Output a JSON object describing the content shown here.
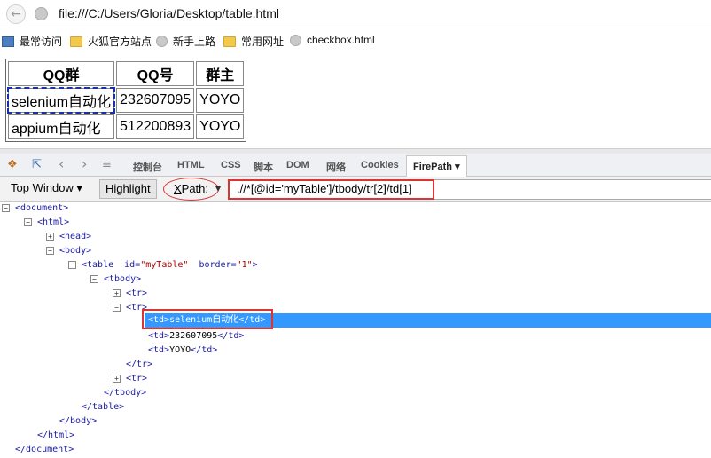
{
  "browser": {
    "url": "file:///C:/Users/Gloria/Desktop/table.html",
    "bookmarks": [
      {
        "label": "最常访问",
        "icon": "bookmarks-star-icon"
      },
      {
        "label": "火狐官方站点",
        "icon": "folder-icon"
      },
      {
        "label": "新手上路",
        "icon": "globe-icon"
      },
      {
        "label": "常用网址",
        "icon": "folder-icon"
      },
      {
        "label": "checkbox.html",
        "icon": "globe-icon"
      }
    ]
  },
  "page_table": {
    "headers": [
      "QQ群",
      "QQ号",
      "群主"
    ],
    "rows": [
      [
        "selenium自动化",
        "232607095",
        "YOYO"
      ],
      [
        "appium自动化",
        "512200893",
        "YOYO"
      ]
    ]
  },
  "devtools": {
    "tabs": [
      "控制台",
      "HTML",
      "CSS",
      "脚本",
      "DOM",
      "网络",
      "Cookies",
      "FirePath ▾"
    ],
    "window_select": "Top Window ▾",
    "highlight": "Highlight",
    "xpath_label_x": "X",
    "xpath_label_rest": "Path:",
    "xpath_value": ".//*[@id='myTable']/tbody/tr[2]/td[1]"
  },
  "tree": {
    "document_open": "<document>",
    "html_open": "<html>",
    "head": "<head>",
    "body_open": "<body>",
    "table_tag_start": "<table  id=",
    "table_id": "\"myTable\"",
    "table_border_attr": "  border=",
    "table_border_val": "\"1\"",
    "table_tag_end": ">",
    "tbody_open": "<tbody>",
    "tr_collapsed_1": "<tr>",
    "tr_open": "<tr>",
    "td1": "<td>selenium自动化</td>",
    "td2_open": "<td>",
    "td2_text": "232607095",
    "td2_close": "</td>",
    "td3_open": "<td>",
    "td3_text": "YOYO",
    "td3_close": "</td>",
    "tr_close": "</tr>",
    "tr_collapsed_2": "<tr>",
    "tbody_close": "</tbody>",
    "table_close": "</table>",
    "body_close": "</body>",
    "html_close": "</html>",
    "document_close": "</document>"
  },
  "colors": {
    "selection": "#3399ff",
    "annotation_red": "#dd3333"
  }
}
